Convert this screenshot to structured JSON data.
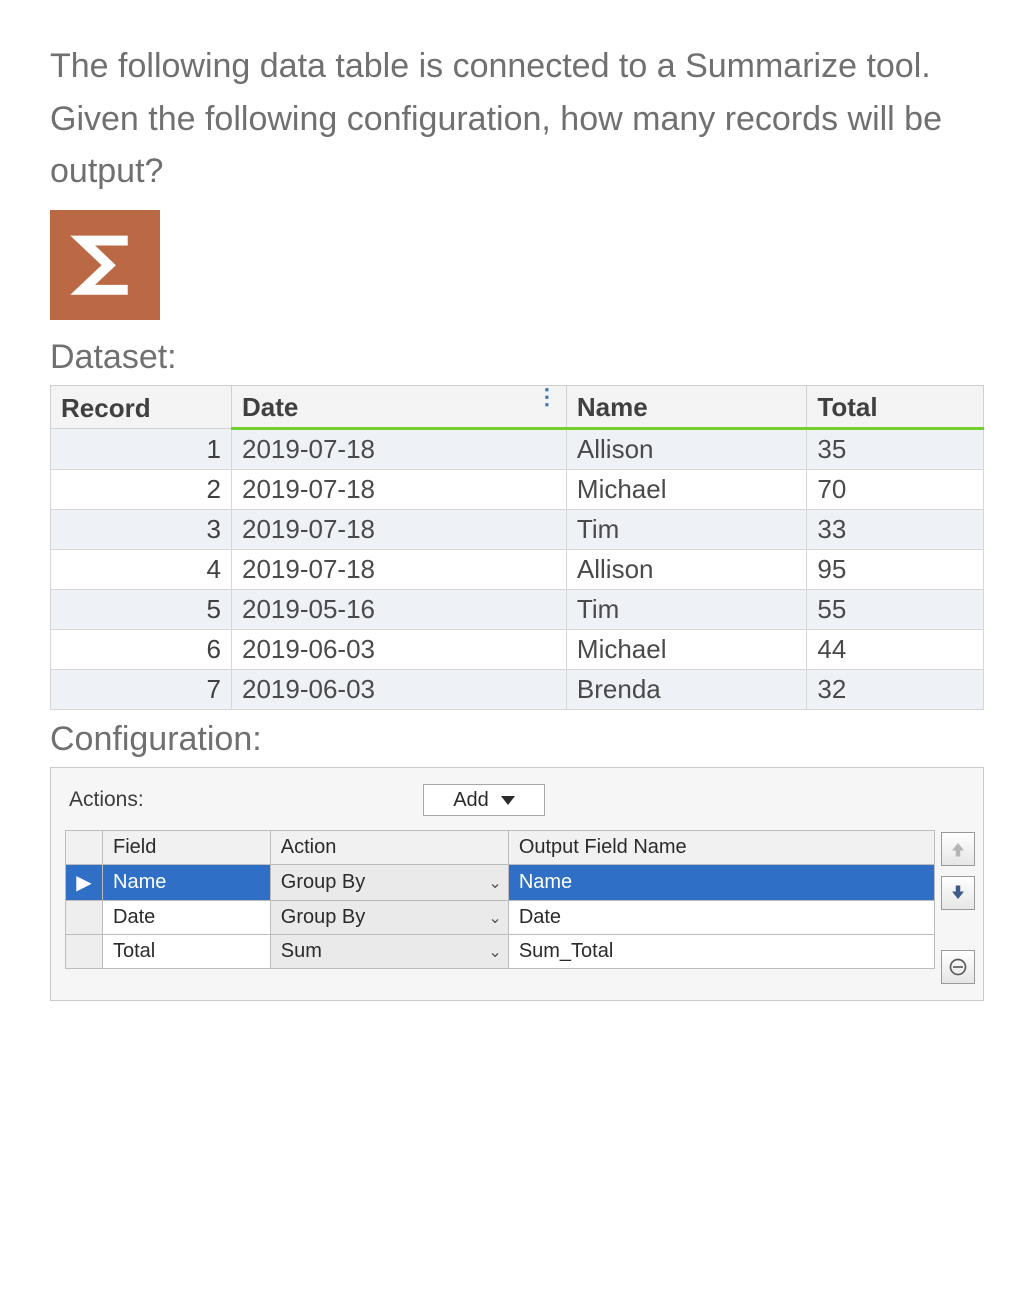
{
  "question": "The following data table is connected to a Summarize tool. Given the following configuration, how many records will be output?",
  "labels": {
    "dataset": "Dataset:",
    "configuration": "Configuration:",
    "actions": "Actions:",
    "add": "Add"
  },
  "dataset": {
    "headers": {
      "record": "Record",
      "date": "Date",
      "name": "Name",
      "total": "Total"
    },
    "rows": [
      {
        "record": "1",
        "date": "2019-07-18",
        "name": "Allison",
        "total": "35"
      },
      {
        "record": "2",
        "date": "2019-07-18",
        "name": "Michael",
        "total": "70"
      },
      {
        "record": "3",
        "date": "2019-07-18",
        "name": "Tim",
        "total": "33"
      },
      {
        "record": "4",
        "date": "2019-07-18",
        "name": "Allison",
        "total": "95"
      },
      {
        "record": "5",
        "date": "2019-05-16",
        "name": "Tim",
        "total": "55"
      },
      {
        "record": "6",
        "date": "2019-06-03",
        "name": "Michael",
        "total": "44"
      },
      {
        "record": "7",
        "date": "2019-06-03",
        "name": "Brenda",
        "total": "32"
      }
    ]
  },
  "config": {
    "headers": {
      "field": "Field",
      "action": "Action",
      "output": "Output Field Name"
    },
    "rows": [
      {
        "marker": "▶",
        "field": "Name",
        "action": "Group By",
        "output": "Name",
        "selected": true
      },
      {
        "marker": "",
        "field": "Date",
        "action": "Group By",
        "output": "Date",
        "selected": false
      },
      {
        "marker": "",
        "field": "Total",
        "action": "Sum",
        "output": "Sum_Total",
        "selected": false
      }
    ]
  }
}
